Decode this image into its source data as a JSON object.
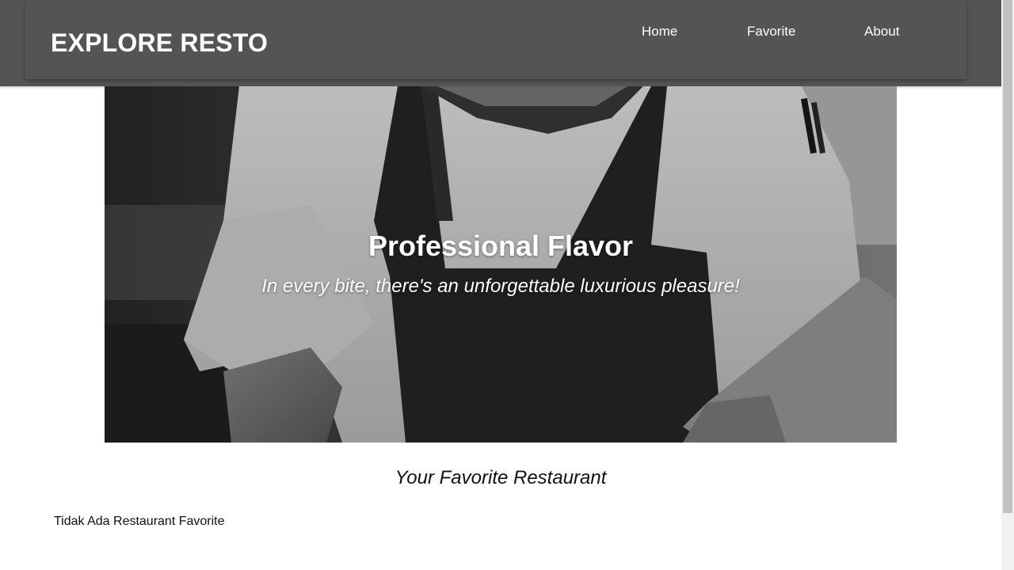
{
  "header": {
    "brand": "EXPLORE RESTO",
    "nav": [
      {
        "label": "Home"
      },
      {
        "label": "Favorite"
      },
      {
        "label": "About"
      }
    ]
  },
  "hero": {
    "title": "Professional Flavor",
    "tagline": "In every bite, there's an unforgettable luxurious pleasure!"
  },
  "main": {
    "section_title": "Your Favorite Restaurant",
    "empty_message": "Tidak Ada Restaurant Favorite"
  },
  "colors": {
    "header_bg": "#545454",
    "text_light": "#ffffff",
    "text_dark": "#111111"
  },
  "icons": {
    "hero_image": "chef-in-apron-photo"
  }
}
